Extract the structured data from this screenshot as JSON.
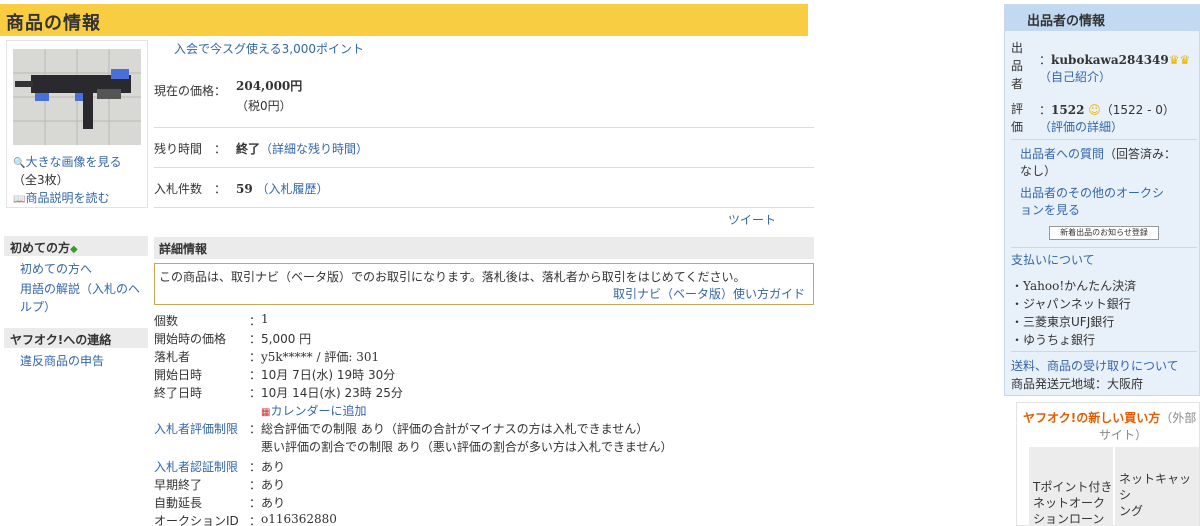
{
  "page_title": "商品の情報",
  "thumb": {
    "large_image_link": "大きな画像を見る",
    "count": "（全3枚）",
    "desc_link": "商品説明を読む"
  },
  "promo": "入会で今スグ使える3,000ポイント",
  "price": {
    "label": "現在の価格：",
    "value": "204,000円",
    "tax": "（税0円）"
  },
  "time_left": {
    "label": "残り時間　：",
    "value": "終了",
    "link": "（詳細な残り時間）"
  },
  "bids": {
    "label": "入札件数　：",
    "value": "59",
    "link": "（入札履歴）"
  },
  "tweet": "ツイート",
  "sidebar": {
    "beginners_head": "初めての方",
    "beginners_links": [
      "初めての方へ",
      "用語の解説（入札のヘ",
      "ルプ）"
    ],
    "contact_head": "ヤフオク!への連絡",
    "contact_links": [
      "違反商品の申告"
    ]
  },
  "details": {
    "head": "詳細情報",
    "notice": "この商品は、取引ナビ（ベータ版）でのお取引になります。落札後は、落札者から取引をはじめてください。",
    "notice_link": "取引ナビ（ベータ版）使い方ガイド",
    "rows": [
      {
        "k": "個数",
        "v": "1"
      },
      {
        "k": "開始時の価格",
        "v": "5,000 円"
      },
      {
        "k": "落札者",
        "v": "y5k***** / 評価: 301"
      },
      {
        "k": "開始日時",
        "v": "10月 7日(水) 19時 30分"
      },
      {
        "k": "終了日時",
        "v": "10月 14日(水) 23時 25分"
      },
      {
        "k": "",
        "v": "カレンダーに追加"
      },
      {
        "k": "入札者評価制限",
        "v": "総合評価での制限 あり（評価の合計がマイナスの方は入札できません）"
      },
      {
        "k": "",
        "v": "悪い評価の割合での制限 あり（悪い評価の割合が多い方は入札できません）"
      },
      {
        "k": "入札者認証制限",
        "v": "あり"
      },
      {
        "k": "早期終了",
        "v": "あり"
      },
      {
        "k": "自動延長",
        "v": "あり"
      },
      {
        "k": "オークションID",
        "v": "o116362880"
      }
    ]
  },
  "seller": {
    "head": "出品者の情報",
    "label_seller": [
      "出",
      "品",
      "者"
    ],
    "label_rating": [
      "評",
      "価"
    ],
    "name": "kubokawa284349",
    "intro": "（自己紹介）",
    "rating": "1522",
    "rating_detail": "（1522 - 0）",
    "rating_link": "（評価の詳細）",
    "question": "出品者への質問",
    "question_count": "（回答済み：",
    "question_count2": "なし）",
    "other_auctions": "出品者のその他のオークシ",
    "other_auctions2": "ョンを見る",
    "register_btn": "新着出品のお知らせ登録",
    "payment_head": "支払いについて",
    "payments": [
      "Yahoo!かんたん決済",
      "ジャパンネット銀行",
      "三菱東京UFJ銀行",
      "ゆうちょ銀行"
    ],
    "shipping_link": "送料、商品の受け取りについて",
    "ship_from": "商品発送元地域：大阪府"
  },
  "new_way": {
    "title": "ヤフオク!の新しい買い方",
    "title_gray": "（外部",
    "title_gray2": "サイト）",
    "cell1": [
      "Tポイント付き",
      "ネットオーク",
      "ションローン"
    ],
    "cell2": [
      "ネットキャッシ",
      "ング"
    ]
  }
}
